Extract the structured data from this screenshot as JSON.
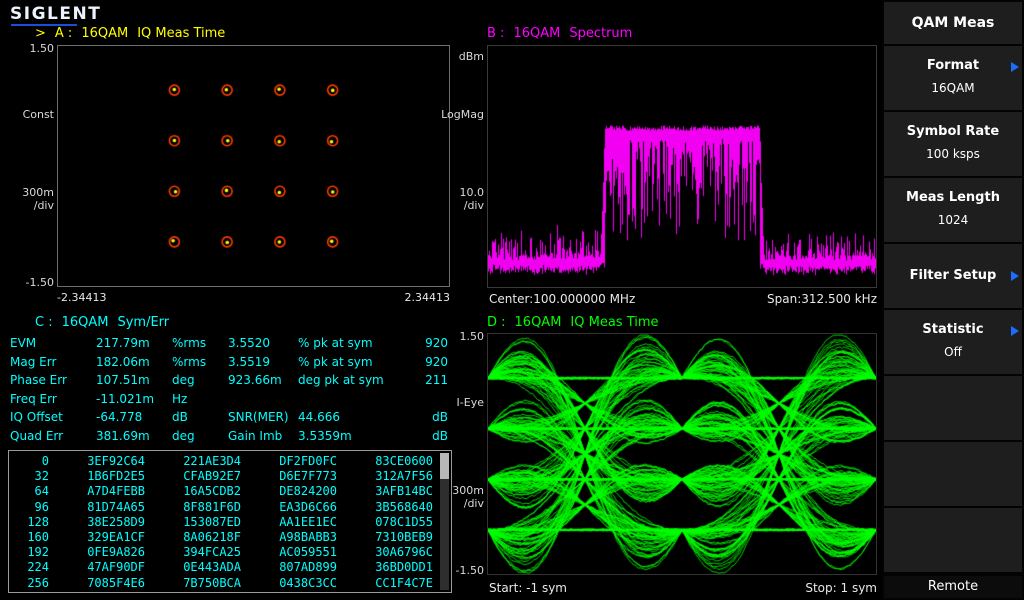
{
  "brand": {
    "logo_text": "SIGLENT"
  },
  "colors": {
    "window_a": "#ffff00",
    "window_b": "#ff00ff",
    "window_c": "#00ffff",
    "window_d": "#00ff00",
    "submenu_arrow": "#1b6dff"
  },
  "windows": {
    "a": {
      "active_marker": ">",
      "id_label": "A :",
      "format": "16QAM",
      "meas_name": "IQ Meas Time",
      "axis": {
        "y_top": "1.50",
        "y_name": "Const",
        "y_scale": "300m",
        "y_scale_unit": "/div",
        "y_bottom": "-1.50",
        "x_left": "-2.34413",
        "x_right": "2.34413"
      }
    },
    "b": {
      "id_label": "B :",
      "format": "16QAM",
      "meas_name": "Spectrum",
      "axis": {
        "y_top": "dBm",
        "y_name": "LogMag",
        "y_scale": "10.0",
        "y_scale_unit": "/div"
      },
      "footer": {
        "left": "Center:100.000000 MHz",
        "right": "Span:312.500 kHz"
      }
    },
    "c": {
      "id_label": "C :",
      "format": "16QAM",
      "meas_name": "Sym/Err",
      "measurements": [
        {
          "name": "EVM",
          "v1": "217.79m",
          "u1": "%rms",
          "v2": "3.5520",
          "u2": "% pk at sym",
          "v3": "920"
        },
        {
          "name": "Mag Err",
          "v1": "182.06m",
          "u1": "%rms",
          "v2": "3.5519",
          "u2": "% pk at sym",
          "v3": "920"
        },
        {
          "name": "Phase Err",
          "v1": "107.51m",
          "u1": "deg",
          "v2": "923.66m",
          "u2": "deg pk at sym",
          "v3": "211"
        },
        {
          "name": "Freq Err",
          "v1": "-11.021m",
          "u1": "Hz",
          "v2": "",
          "u2": "",
          "v3": ""
        },
        {
          "name": "IQ Offset",
          "v1": "-64.778",
          "u1": "dB",
          "v2": "SNR(MER)",
          "u2": "44.666",
          "v3": "dB"
        },
        {
          "name": "Quad Err",
          "v1": "381.69m",
          "u1": "deg",
          "v2": "Gain Imb",
          "u2": "3.5359m",
          "v3": "dB"
        }
      ],
      "symbol_table": [
        {
          "index": "0",
          "cells": [
            "3EF92C64",
            "221AE3D4",
            "DF2FD0FC",
            "83CE0600"
          ]
        },
        {
          "index": "32",
          "cells": [
            "1B6FD2E5",
            "CFAB92E7",
            "D6E7F773",
            "312A7F56"
          ]
        },
        {
          "index": "64",
          "cells": [
            "A7D4FEBB",
            "16A5CDB2",
            "DE824200",
            "3AFB14BC"
          ]
        },
        {
          "index": "96",
          "cells": [
            "81D74A65",
            "8F881F6D",
            "EA3D6C66",
            "3B568640"
          ]
        },
        {
          "index": "128",
          "cells": [
            "38E258D9",
            "153087ED",
            "AA1EE1EC",
            "078C1D55"
          ]
        },
        {
          "index": "160",
          "cells": [
            "329EA1CF",
            "8A06218F",
            "A98BABB3",
            "7310BEB9"
          ]
        },
        {
          "index": "192",
          "cells": [
            "0FE9A826",
            "394FCA25",
            "AC059551",
            "30A6796C"
          ]
        },
        {
          "index": "224",
          "cells": [
            "47AF90DF",
            "0E443ADA",
            "807AD899",
            "36BD0DD1"
          ]
        },
        {
          "index": "256",
          "cells": [
            "7085F4E6",
            "7B750BCA",
            "0438C3CC",
            "CC1F4C7E"
          ]
        }
      ]
    },
    "d": {
      "id_label": "D :",
      "format": "16QAM",
      "meas_name": "IQ Meas Time",
      "axis": {
        "y_top": "1.50",
        "y_name": "I-Eye",
        "y_scale": "300m",
        "y_scale_unit": "/div",
        "y_bottom": "-1.50"
      },
      "footer": {
        "left": "Start: -1 sym",
        "right": "Stop: 1 sym"
      }
    }
  },
  "sidebar": {
    "header": "QAM Meas",
    "buttons": [
      {
        "label": "Format",
        "value": "16QAM",
        "arrow": true
      },
      {
        "label": "Symbol Rate",
        "value": "100 ksps",
        "arrow": false
      },
      {
        "label": "Meas Length",
        "value": "1024",
        "arrow": false
      },
      {
        "label": "Filter Setup",
        "value": "",
        "arrow": true
      },
      {
        "label": "Statistic",
        "value": "Off",
        "arrow": true
      },
      {
        "label": "",
        "value": "",
        "arrow": false
      },
      {
        "label": "",
        "value": "",
        "arrow": false
      },
      {
        "label": "",
        "value": "",
        "arrow": false
      }
    ],
    "footer": "Remote"
  },
  "chart_data": [
    {
      "id": "constellation",
      "type": "scatter",
      "title": "A : 16QAM IQ Meas Time (constellation)",
      "xlabel": "",
      "ylabel": "Const",
      "x_range": [
        -2.34413,
        2.34413
      ],
      "y_range": [
        -1.5,
        1.5
      ],
      "y_scale_per_div": 0.3,
      "levels": [
        -0.9487,
        -0.3162,
        0.3162,
        0.9487
      ],
      "points_note": "16 ideal 16QAM states at all (I,Q) level pairs, measured dots near ideal rings",
      "ring_color": "#ff3c00",
      "dot_color": "#ffff00"
    },
    {
      "id": "spectrum",
      "type": "line",
      "title": "B : 16QAM Spectrum",
      "center_label": "Center:100.000000 MHz",
      "span_label": "Span:312.500 kHz",
      "amplitude_unit": "dBm",
      "scale_per_div_db": 10.0,
      "color": "#ff00ff",
      "band_left_frac": 0.3,
      "band_right_frac": 0.7,
      "band_top_frac": 0.33,
      "noise_floor_frac": 0.9
    },
    {
      "id": "eye",
      "type": "line",
      "title": "D : 16QAM IQ Meas Time (I-Eye)",
      "x_range_sym": [
        -1,
        1
      ],
      "y_range": [
        -1.5,
        1.5
      ],
      "y_scale_per_div": 0.3,
      "levels": [
        -0.9487,
        -0.3162,
        0.3162,
        0.9487
      ],
      "color": "#00ff00"
    }
  ]
}
